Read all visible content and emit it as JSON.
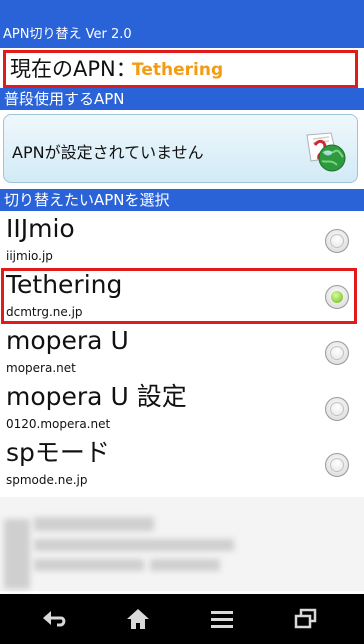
{
  "app": {
    "title": "APN切り替え Ver 2.0"
  },
  "current": {
    "label": "現在のAPN：",
    "value": "Tethering"
  },
  "section_usual": {
    "label": "普段使用するAPN"
  },
  "apn_card": {
    "text": "APNが設定されていません",
    "icon": "apn-settings-globe-icon"
  },
  "section_select": {
    "label": "切り替えたいAPNを選択"
  },
  "apn_list": [
    {
      "name": "IIJmio",
      "host": "iijmio.jp",
      "selected": false
    },
    {
      "name": "Tethering",
      "host": "dcmtrg.ne.jp",
      "selected": true
    },
    {
      "name": "mopera U",
      "host": "mopera.net",
      "selected": false
    },
    {
      "name": "mopera U 設定",
      "host": "0120.mopera.net",
      "selected": false
    },
    {
      "name": "spモード",
      "host": "spmode.ne.jp",
      "selected": false
    }
  ],
  "navbar": {
    "icons": [
      "back-icon",
      "home-icon",
      "menu-icon",
      "recent-apps-icon"
    ]
  },
  "colors": {
    "header": "#2a62d8",
    "highlight_border": "#e11a1a",
    "current_value": "#f39c12",
    "radio_selected": "#6db51d"
  }
}
